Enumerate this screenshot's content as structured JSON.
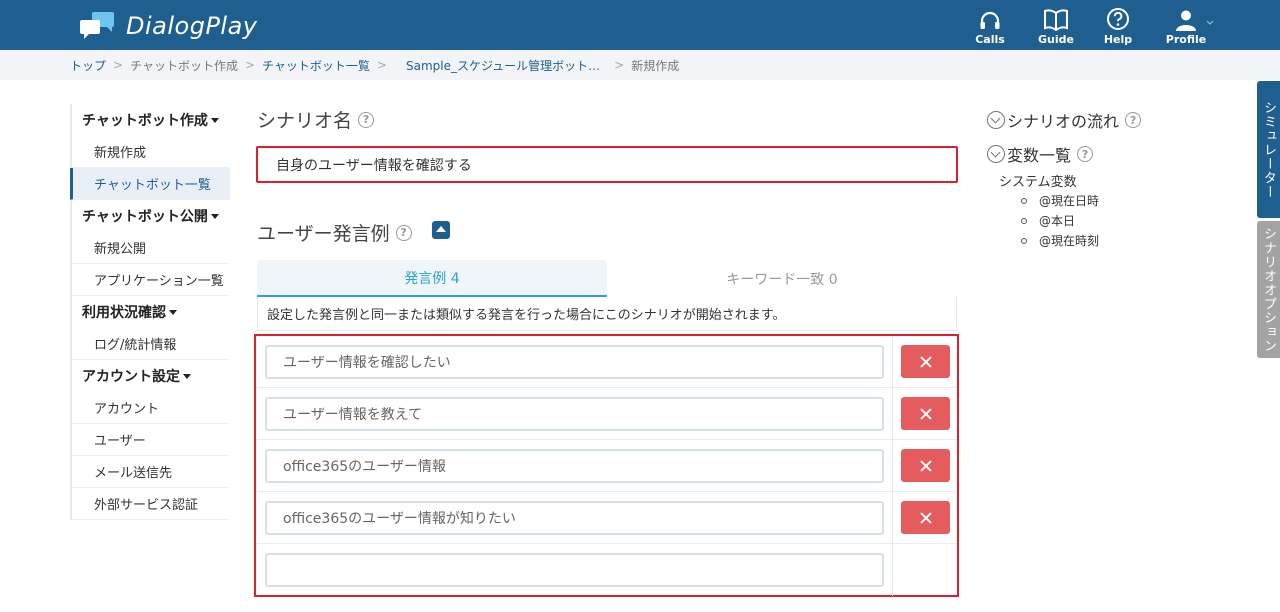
{
  "app": {
    "title": "DialogPlay"
  },
  "header_nav": [
    {
      "label": "Calls",
      "icon": "headset-icon"
    },
    {
      "label": "Guide",
      "icon": "book-icon"
    },
    {
      "label": "Help",
      "icon": "question-icon"
    },
    {
      "label": "Profile",
      "icon": "user-icon"
    }
  ],
  "breadcrumb": [
    "トップ",
    "チャットボット作成",
    "チャットボット一覧",
    "Sample_スケジュール管理ボット…",
    "新規作成"
  ],
  "sidebar": {
    "groups": [
      {
        "title": "チャットボット作成",
        "items": [
          "新規作成",
          "チャットボット一覧"
        ]
      },
      {
        "title": "チャットボット公開",
        "items": [
          "新規公開",
          "アプリケーション一覧"
        ]
      },
      {
        "title": "利用状況確認",
        "items": [
          "ログ/統計情報"
        ]
      },
      {
        "title": "アカウント設定",
        "items": [
          "アカウント",
          "ユーザー",
          "メール送信先",
          "外部サービス認証"
        ]
      }
    ],
    "active_item": "チャットボット一覧"
  },
  "scenario": {
    "name_label": "シナリオ名",
    "name_value": "自身のユーザー情報を確認する"
  },
  "utterances": {
    "label": "ユーザー発言例",
    "tabs": [
      "発言例 4",
      "キーワード一致 0"
    ],
    "description": "設定した発言例と同一または類似する発言を行った場合にこのシナリオが開始されます。",
    "examples": [
      "ユーザー情報を確認したい",
      "ユーザー情報を教えて",
      "office365のユーザー情報",
      "office365のユーザー情報が知りたい",
      ""
    ]
  },
  "right_panel": {
    "flow_label": "シナリオの流れ",
    "vars_label": "変数一覧",
    "system_vars_label": "システム変数",
    "system_vars": [
      "@現在日時",
      "@本日",
      "@現在時刻"
    ]
  },
  "side_tabs": [
    "シミュレーター",
    "シナリオオプション"
  ],
  "colors": {
    "header": "#1f5f8f",
    "accent": "#29a3d6",
    "danger": "#e55c5f",
    "highlight": "#d9212c"
  }
}
